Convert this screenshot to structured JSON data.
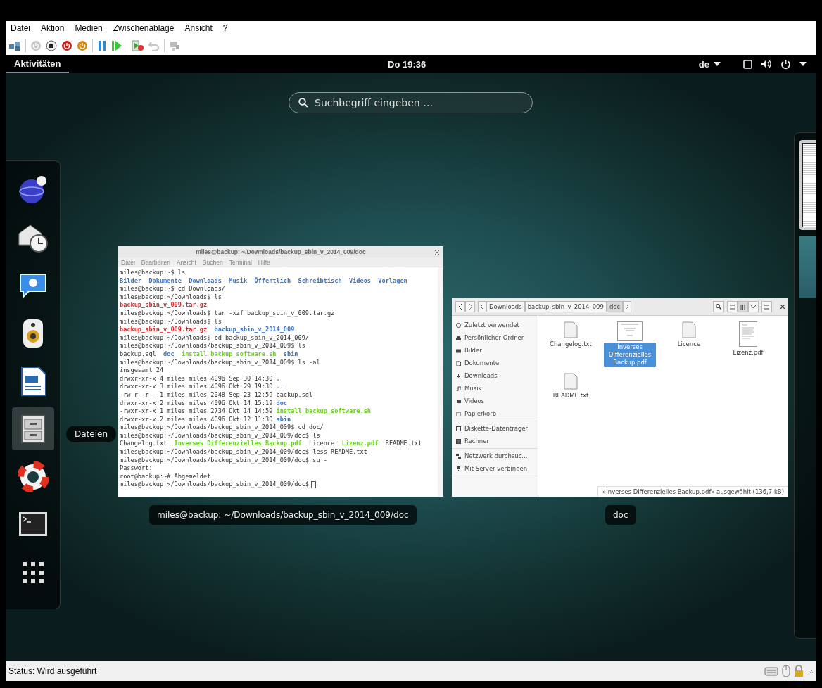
{
  "vm_menu": [
    "Datei",
    "Aktion",
    "Medien",
    "Zwischenablage",
    "Ansicht",
    "?"
  ],
  "top_bar": {
    "activities": "Aktivitäten",
    "clock": "Do 19:36",
    "keyboard": "de"
  },
  "search": {
    "placeholder": "Suchbegriff eingeben …"
  },
  "dock": {
    "items": [
      {
        "kind": "browser",
        "selected": false
      },
      {
        "kind": "mail",
        "selected": false
      },
      {
        "kind": "chat",
        "selected": false
      },
      {
        "kind": "speaker",
        "selected": false
      },
      {
        "kind": "writer",
        "selected": false
      },
      {
        "kind": "files",
        "selected": true
      },
      {
        "kind": "help",
        "selected": false
      },
      {
        "kind": "terminal",
        "selected": false
      },
      {
        "kind": "grid",
        "selected": false
      }
    ],
    "tooltip": "Dateien"
  },
  "terminal": {
    "title": "miles@backup: ~/Downloads/backup_sbin_v_2014_009/doc",
    "menu": [
      "Datei",
      "Bearbeiten",
      "Ansicht",
      "Suchen",
      "Terminal",
      "Hilfe"
    ],
    "lines": [
      [
        {
          "text": "miles@backup:~$ ls",
          "kind": "plain"
        }
      ],
      [
        {
          "text": "Bilder  Dokumente  Downloads  Musik  Öffentlich  Schreibtisch  Videos  Vorlagen",
          "kind": "dir"
        }
      ],
      [
        {
          "text": "miles@backup:~$ cd Downloads/",
          "kind": "plain"
        }
      ],
      [
        {
          "text": "miles@backup:~/Downloads$ ls",
          "kind": "plain"
        }
      ],
      [
        {
          "text": "backup_sbin_v_009.tar.gz",
          "kind": "archive"
        }
      ],
      [
        {
          "text": "miles@backup:~/Downloads$ tar -xzf backup_sbin_v_009.tar.gz",
          "kind": "plain"
        }
      ],
      [
        {
          "text": "miles@backup:~/Downloads$ ls",
          "kind": "plain"
        }
      ],
      [
        {
          "text": "backup_sbin_v_009.tar.gz",
          "kind": "archive"
        },
        {
          "text": "  backup_sbin_v_2014_009",
          "kind": "dir"
        }
      ],
      [
        {
          "text": "miles@backup:~/Downloads$ cd backup_sbin_v_2014_009/",
          "kind": "plain"
        }
      ],
      [
        {
          "text": "miles@backup:~/Downloads/backup_sbin_v_2014_009$ ls",
          "kind": "plain"
        }
      ],
      [
        {
          "text": "backup.sql",
          "kind": "plain"
        },
        {
          "text": "  doc",
          "kind": "dir"
        },
        {
          "text": "  install_backup_software.sh",
          "kind": "exec"
        },
        {
          "text": "  sbin",
          "kind": "dir"
        }
      ],
      [
        {
          "text": "miles@backup:~/Downloads/backup_sbin_v_2014_009$ ls -al",
          "kind": "plain"
        }
      ],
      [
        {
          "text": "insgesamt 24",
          "kind": "plain"
        }
      ],
      [
        {
          "text": "drwxr-xr-x 4 miles miles 4096 Sep 30 14:30",
          "kind": "plain"
        },
        {
          "text": " .",
          "kind": "dir"
        }
      ],
      [
        {
          "text": "drwxr-xr-x 3 miles miles 4096 Okt 29 19:30",
          "kind": "plain"
        },
        {
          "text": " ..",
          "kind": "dir"
        }
      ],
      [
        {
          "text": "-rw-r--r-- 1 miles miles 2048 Sep 23 12:59 backup.sql",
          "kind": "plain"
        }
      ],
      [
        {
          "text": "drwxr-xr-x 2 miles miles 4096 Okt 14 15:19",
          "kind": "plain"
        },
        {
          "text": " doc",
          "kind": "dir"
        }
      ],
      [
        {
          "text": "-rwxr-xr-x 1 miles miles 2734 Okt 14 14:59",
          "kind": "plain"
        },
        {
          "text": " install_backup_software.sh",
          "kind": "exec"
        }
      ],
      [
        {
          "text": "drwxr-xr-x 2 miles miles 4096 Okt 12 11:30",
          "kind": "plain"
        },
        {
          "text": " sbin",
          "kind": "dir"
        }
      ],
      [
        {
          "text": "miles@backup:~/Downloads/backup_sbin_v_2014_009$ cd doc/",
          "kind": "plain"
        }
      ],
      [
        {
          "text": "miles@backup:~/Downloads/backup_sbin_v_2014_009/doc$ ls",
          "kind": "plain"
        }
      ],
      [
        {
          "text": "Changelog.txt",
          "kind": "plain"
        },
        {
          "text": "  Inverses Differenzielles Backup.pdf",
          "kind": "exec"
        },
        {
          "text": "  Licence",
          "kind": "plain"
        },
        {
          "text": "  Lizenz.pdf",
          "kind": "exec"
        },
        {
          "text": "  README.txt",
          "kind": "plain"
        }
      ],
      [
        {
          "text": "miles@backup:~/Downloads/backup_sbin_v_2014_009/doc$ less README.txt",
          "kind": "plain"
        }
      ],
      [
        {
          "text": "miles@backup:~/Downloads/backup_sbin_v_2014_009/doc$ su -",
          "kind": "plain"
        }
      ],
      [
        {
          "text": "Passwort:",
          "kind": "plain"
        }
      ],
      [
        {
          "text": "root@backup:~# Abgemeldet",
          "kind": "plain"
        }
      ],
      [
        {
          "text": "miles@backup:~/Downloads/backup_sbin_v_2014_009/doc$",
          "kind": "plain"
        }
      ]
    ],
    "caption": "miles@backup: ~/Downloads/backup_sbin_v_2014_009/doc"
  },
  "file_manager": {
    "path": [
      {
        "label": "Downloads",
        "selected": false
      },
      {
        "label": "backup_sbin_v_2014_009",
        "selected": false
      },
      {
        "label": "doc",
        "selected": true
      }
    ],
    "sidebar": [
      [
        {
          "label": "Zuletzt verwendet",
          "kind": "clock"
        },
        {
          "label": "Persönlicher Ordner",
          "kind": "home"
        },
        {
          "label": "Bilder",
          "kind": "camera"
        },
        {
          "label": "Dokumente",
          "kind": "document"
        },
        {
          "label": "Downloads",
          "kind": "download"
        },
        {
          "label": "Musik",
          "kind": "music"
        },
        {
          "label": "Videos",
          "kind": "video"
        },
        {
          "label": "Papierkorb",
          "kind": "trash"
        }
      ],
      [
        {
          "label": "Diskette-Datenträger",
          "kind": "drive"
        },
        {
          "label": "Rechner",
          "kind": "computer"
        }
      ],
      [
        {
          "label": "Netzwerk durchsuc...",
          "kind": "network"
        },
        {
          "label": "Mit Server verbinden",
          "kind": "server"
        }
      ]
    ],
    "files": [
      {
        "name": "Changelog.txt",
        "kind": "text",
        "selected": false
      },
      {
        "name": "Inverses Differenzielles Backup.pdf",
        "kind": "pdf",
        "selected": true
      },
      {
        "name": "Licence",
        "kind": "text",
        "selected": false
      },
      {
        "name": "Lizenz.pdf",
        "kind": "pdf",
        "selected": false
      },
      {
        "name": "README.txt",
        "kind": "text",
        "selected": false
      }
    ],
    "status": "»Inverses Differenzielles Backup.pdf« ausgewählt  (136,7 kB)",
    "caption": "doc"
  },
  "status_bar": {
    "text": "Status: Wird ausgeführt"
  }
}
